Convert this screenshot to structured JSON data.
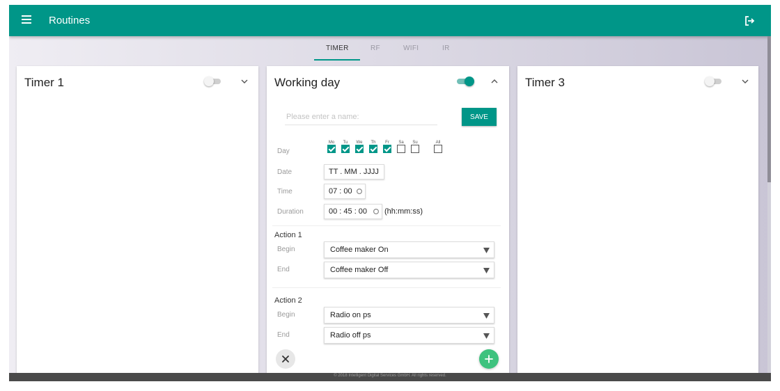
{
  "header": {
    "title": "Routines",
    "menu_icon": "hamburger-menu-icon",
    "logout_icon": "logout-icon"
  },
  "tabs": [
    {
      "label": "TIMER",
      "active": true
    },
    {
      "label": "RF",
      "active": false
    },
    {
      "label": "WIFI",
      "active": false
    },
    {
      "label": "IR",
      "active": false
    }
  ],
  "cards": {
    "timer1": {
      "title": "Timer 1",
      "enabled": false,
      "expanded": false
    },
    "working_day": {
      "title": "Working day",
      "enabled": true,
      "expanded": true,
      "name_placeholder": "Please enter a name:",
      "name_value": "",
      "save_label": "SAVE",
      "labels": {
        "day": "Day",
        "date": "Date",
        "time": "Time",
        "duration": "Duration",
        "begin": "Begin",
        "end": "End"
      },
      "days": [
        {
          "abbr": "Mo",
          "checked": true
        },
        {
          "abbr": "Tu",
          "checked": true
        },
        {
          "abbr": "We",
          "checked": true
        },
        {
          "abbr": "Th",
          "checked": true
        },
        {
          "abbr": "Fr",
          "checked": true
        },
        {
          "abbr": "Sa",
          "checked": false
        },
        {
          "abbr": "Su",
          "checked": false
        }
      ],
      "all_day": {
        "abbr": "All",
        "checked": false
      },
      "date_value": "TT . MM . JJJJ",
      "time_value": "07 : 00",
      "duration_value": "00 : 45 : 00",
      "duration_hint": "(hh:mm:ss)",
      "actions": [
        {
          "title": "Action 1",
          "begin": "Coffee maker On",
          "end": "Coffee maker Off"
        },
        {
          "title": "Action 2",
          "begin": "Radio on ps",
          "end": "Radio off ps"
        }
      ]
    },
    "timer3": {
      "title": "Timer 3",
      "enabled": false,
      "expanded": false
    }
  },
  "footer": {
    "text": "© 2018 Intelligent Digital Services GmbH. All rights reserved."
  },
  "colors": {
    "accent": "#009688",
    "add_button": "#3ec27e",
    "footer": "#4a4a4a"
  }
}
